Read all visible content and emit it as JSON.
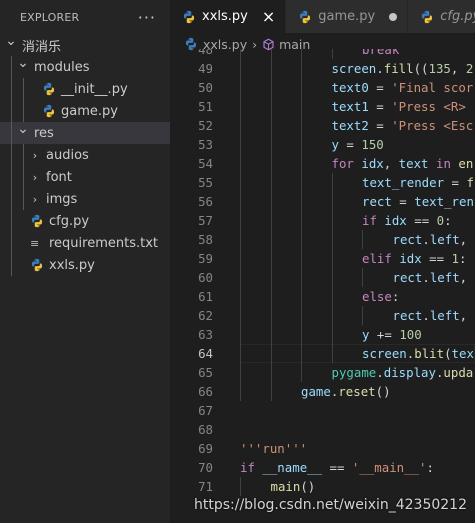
{
  "explorer": {
    "title": "EXPLORER",
    "more": "···",
    "items": [
      {
        "label": "消消乐",
        "type": "folder",
        "open": true,
        "depth": 0
      },
      {
        "label": "modules",
        "type": "folder",
        "open": true,
        "depth": 1
      },
      {
        "label": "__init__.py",
        "type": "py",
        "depth": 2
      },
      {
        "label": "game.py",
        "type": "py",
        "depth": 2
      },
      {
        "label": "res",
        "type": "folder",
        "open": true,
        "depth": 1,
        "selected": true
      },
      {
        "label": "audios",
        "type": "folder",
        "open": false,
        "depth": 2
      },
      {
        "label": "font",
        "type": "folder",
        "open": false,
        "depth": 2
      },
      {
        "label": "imgs",
        "type": "folder",
        "open": false,
        "depth": 2
      },
      {
        "label": "cfg.py",
        "type": "py",
        "depth": 1
      },
      {
        "label": "requirements.txt",
        "type": "txt",
        "depth": 1
      },
      {
        "label": "xxls.py",
        "type": "py",
        "depth": 1
      }
    ]
  },
  "tabs": [
    {
      "label": "xxls.py",
      "active": true,
      "indicator": "×"
    },
    {
      "label": "game.py",
      "active": false,
      "indicator": "dot"
    },
    {
      "label": "cfg.py",
      "active": false,
      "italic": true
    }
  ],
  "breadcrumb": {
    "file": "xxls.py",
    "symbol": "main"
  },
  "code": {
    "current_line": 64,
    "lines": [
      {
        "n": 48,
        "indent": 4,
        "tokens": [
          [
            "kw",
            "break"
          ]
        ]
      },
      {
        "n": 49,
        "indent": 3,
        "tokens": [
          [
            "var",
            "screen"
          ],
          [
            "plain",
            "."
          ],
          [
            "fn",
            "fill"
          ],
          [
            "plain",
            "(("
          ],
          [
            "num",
            "135"
          ],
          [
            "plain",
            ", "
          ],
          [
            "num",
            "2"
          ]
        ]
      },
      {
        "n": 50,
        "indent": 3,
        "tokens": [
          [
            "var",
            "text0"
          ],
          [
            "plain",
            " = "
          ],
          [
            "str",
            "'Final scor"
          ]
        ]
      },
      {
        "n": 51,
        "indent": 3,
        "tokens": [
          [
            "var",
            "text1"
          ],
          [
            "plain",
            " = "
          ],
          [
            "str",
            "'Press <R> "
          ]
        ]
      },
      {
        "n": 52,
        "indent": 3,
        "tokens": [
          [
            "var",
            "text2"
          ],
          [
            "plain",
            " = "
          ],
          [
            "str",
            "'Press <Esc"
          ]
        ]
      },
      {
        "n": 53,
        "indent": 3,
        "tokens": [
          [
            "var",
            "y"
          ],
          [
            "plain",
            " = "
          ],
          [
            "num",
            "150"
          ]
        ]
      },
      {
        "n": 54,
        "indent": 3,
        "tokens": [
          [
            "kw",
            "for"
          ],
          [
            "plain",
            " "
          ],
          [
            "var",
            "idx"
          ],
          [
            "plain",
            ", "
          ],
          [
            "var",
            "text"
          ],
          [
            "plain",
            " "
          ],
          [
            "kw",
            "in"
          ],
          [
            "plain",
            " "
          ],
          [
            "fn",
            "en"
          ]
        ]
      },
      {
        "n": 55,
        "indent": 4,
        "tokens": [
          [
            "var",
            "text_render"
          ],
          [
            "plain",
            " = "
          ],
          [
            "fn",
            "f"
          ]
        ]
      },
      {
        "n": 56,
        "indent": 4,
        "tokens": [
          [
            "var",
            "rect"
          ],
          [
            "plain",
            " = "
          ],
          [
            "var",
            "text_ren"
          ]
        ]
      },
      {
        "n": 57,
        "indent": 4,
        "tokens": [
          [
            "kw",
            "if"
          ],
          [
            "plain",
            " "
          ],
          [
            "var",
            "idx"
          ],
          [
            "plain",
            " == "
          ],
          [
            "num",
            "0"
          ],
          [
            "plain",
            ":"
          ]
        ]
      },
      {
        "n": 58,
        "indent": 5,
        "tokens": [
          [
            "var",
            "rect"
          ],
          [
            "plain",
            "."
          ],
          [
            "var",
            "left"
          ],
          [
            "plain",
            ","
          ]
        ]
      },
      {
        "n": 59,
        "indent": 4,
        "tokens": [
          [
            "kw",
            "elif"
          ],
          [
            "plain",
            " "
          ],
          [
            "var",
            "idx"
          ],
          [
            "plain",
            " == "
          ],
          [
            "num",
            "1"
          ],
          [
            "plain",
            ":"
          ]
        ]
      },
      {
        "n": 60,
        "indent": 5,
        "tokens": [
          [
            "var",
            "rect"
          ],
          [
            "plain",
            "."
          ],
          [
            "var",
            "left"
          ],
          [
            "plain",
            ","
          ]
        ]
      },
      {
        "n": 61,
        "indent": 4,
        "tokens": [
          [
            "kw",
            "else"
          ],
          [
            "plain",
            ":"
          ]
        ]
      },
      {
        "n": 62,
        "indent": 5,
        "tokens": [
          [
            "var",
            "rect"
          ],
          [
            "plain",
            "."
          ],
          [
            "var",
            "left"
          ],
          [
            "plain",
            ","
          ]
        ]
      },
      {
        "n": 63,
        "indent": 4,
        "tokens": [
          [
            "var",
            "y"
          ],
          [
            "plain",
            " += "
          ],
          [
            "num",
            "100"
          ]
        ]
      },
      {
        "n": 64,
        "indent": 4,
        "tokens": [
          [
            "var",
            "screen"
          ],
          [
            "plain",
            "."
          ],
          [
            "fn",
            "blit"
          ],
          [
            "plain",
            "("
          ],
          [
            "var",
            "tex"
          ]
        ]
      },
      {
        "n": 65,
        "indent": 3,
        "tokens": [
          [
            "cls",
            "pygame"
          ],
          [
            "plain",
            "."
          ],
          [
            "var",
            "display"
          ],
          [
            "plain",
            "."
          ],
          [
            "fn",
            "upda"
          ]
        ]
      },
      {
        "n": 66,
        "indent": 2,
        "tokens": [
          [
            "var",
            "game"
          ],
          [
            "plain",
            "."
          ],
          [
            "fn",
            "reset"
          ],
          [
            "plain",
            "()"
          ]
        ]
      },
      {
        "n": 67,
        "indent": 0,
        "tokens": []
      },
      {
        "n": 68,
        "indent": 0,
        "tokens": []
      },
      {
        "n": 69,
        "indent": 0,
        "tokens": [
          [
            "str",
            "'''run'''"
          ]
        ]
      },
      {
        "n": 70,
        "indent": 0,
        "tokens": [
          [
            "kw",
            "if"
          ],
          [
            "plain",
            " "
          ],
          [
            "var",
            "__name__"
          ],
          [
            "plain",
            " == "
          ],
          [
            "str",
            "'__main__'"
          ],
          [
            "plain",
            ":"
          ]
        ]
      },
      {
        "n": 71,
        "indent": 1,
        "tokens": [
          [
            "fn",
            "main"
          ],
          [
            "plain",
            "()"
          ]
        ]
      }
    ]
  },
  "watermark": "https://blog.csdn.net/weixin_42350212",
  "colors": {
    "sidebar_bg": "#252526",
    "editor_bg": "#1e1e1e",
    "keyword": "#c586c0",
    "string": "#ce9178",
    "function": "#dcdcaa",
    "variable": "#9cdcfe",
    "number": "#b5cea8",
    "python_icon": "#3c7dbd"
  }
}
